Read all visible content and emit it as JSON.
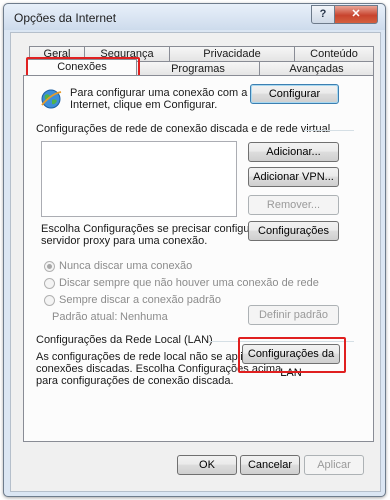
{
  "window": {
    "title": "Opções da Internet",
    "help_label": "?",
    "close_label": "✕"
  },
  "tabs": {
    "row1": [
      "Geral",
      "Segurança",
      "Privacidade",
      "Conteúdo"
    ],
    "row2": [
      "Conexões",
      "Programas",
      "Avançadas"
    ],
    "selected": "Conexões"
  },
  "setup": {
    "icon": "internet-globe-icon",
    "text_line1": "Para configurar uma conexão com a",
    "text_line2": "Internet, clique em Configurar.",
    "button": "Configurar"
  },
  "dialup": {
    "section_title": "Configurações de rede de conexão discada e de rede virtual",
    "buttons": {
      "add": "Adicionar...",
      "add_vpn": "Adicionar VPN...",
      "remove": "Remover...",
      "settings": "Configurações"
    },
    "proxy_note_line1": "Escolha Configurações se precisar configurar um",
    "proxy_note_line2": "servidor proxy para uma conexão.",
    "options": [
      {
        "label": "Nunca discar uma conexão",
        "selected": true
      },
      {
        "label": "Discar sempre que não houver uma conexão de rede",
        "selected": false
      },
      {
        "label": "Sempre discar a conexão padrão",
        "selected": false
      }
    ],
    "current_default_label": "Padrão atual:",
    "current_default_value": "Nenhuma",
    "set_default_button": "Definir padrão"
  },
  "lan": {
    "section_title": "Configurações da Rede Local (LAN)",
    "text_line1": "As configurações de rede local não se aplicam a",
    "text_line2": "conexões discadas. Escolha Configurações acima",
    "text_line3": "para configurações de conexão discada.",
    "button": "Configurações da LAN"
  },
  "footer": {
    "ok": "OK",
    "cancel": "Cancelar",
    "apply": "Aplicar"
  },
  "colors": {
    "highlight": "#e02020"
  }
}
